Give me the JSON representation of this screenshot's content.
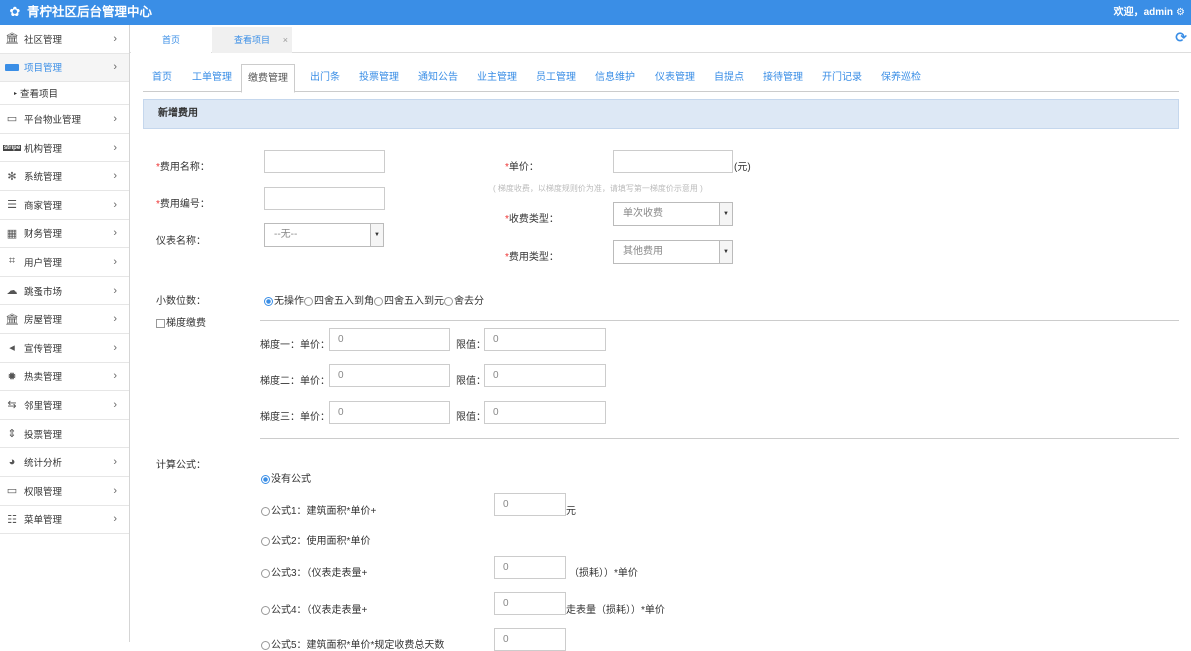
{
  "header": {
    "title": "青柠社区后台管理中心",
    "welcome": "欢迎，admin",
    "gear_icon": "gear-icon"
  },
  "sidebar": {
    "items": [
      {
        "label": "社区管理",
        "icon": "bank-icon"
      },
      {
        "label": "项目管理",
        "icon": "project-icon"
      },
      {
        "label": "平台物业管理",
        "icon": "monitor-icon"
      },
      {
        "label": "机构管理",
        "icon": "stripe-icon"
      },
      {
        "label": "系统管理",
        "icon": "fan-icon"
      },
      {
        "label": "商家管理",
        "icon": "menu-icon"
      },
      {
        "label": "财务管理",
        "icon": "calculator-icon"
      },
      {
        "label": "用户管理",
        "icon": "crop-icon"
      },
      {
        "label": "跳蚤市场",
        "icon": "cloud-icon"
      },
      {
        "label": "房屋管理",
        "icon": "bank-icon"
      },
      {
        "label": "宣传管理",
        "icon": "volume-icon"
      },
      {
        "label": "热卖管理",
        "icon": "settings-icon"
      },
      {
        "label": "邻里管理",
        "icon": "retweet-icon"
      },
      {
        "label": "投票管理",
        "icon": "sort-icon"
      },
      {
        "label": "统计分析",
        "icon": "pie-chart-icon"
      },
      {
        "label": "权限管理",
        "icon": "monitor-icon"
      },
      {
        "label": "菜单管理",
        "icon": "list-icon"
      }
    ],
    "subitem": "查看项目"
  },
  "tabs": [
    {
      "label": "首页"
    },
    {
      "label": "查看项目",
      "close": "×"
    }
  ],
  "subnav": [
    "首页",
    "工单管理",
    "缴费管理",
    "出门条",
    "投票管理",
    "通知公告",
    "业主管理",
    "员工管理",
    "信息维护",
    "仪表管理",
    "自提点",
    "接待管理",
    "开门记录",
    "保养巡检"
  ],
  "form": {
    "heading": "新增费用",
    "fee_name_label": "费用名称：",
    "fee_code_label": "费用编号：",
    "meter_name_label": "仪表名称：",
    "meter_name_value": "--无--",
    "unit_price_label": "单价：",
    "unit_price_suffix": "(元)",
    "unit_price_hint": "( 梯度收费，以梯度规则价为准，请填写第一梯度价示意用 )",
    "charge_type_label": "收费类型：",
    "charge_type_value": "单次收费",
    "fee_type_label": "费用类型：",
    "fee_type_value": "其他费用",
    "decimal_label": "小数位数：",
    "decimal_options": [
      "无操作",
      "四舍五入到角",
      "四舍五入到元",
      "舍去分"
    ],
    "tier_checkbox": "梯度缴费",
    "tiers": [
      {
        "label": "梯度一：单价：",
        "price": "0",
        "limit_label": "限值：",
        "limit": "0"
      },
      {
        "label": "梯度二：单价：",
        "price": "0",
        "limit_label": "限值：",
        "limit": "0"
      },
      {
        "label": "梯度三：单价：",
        "price": "0",
        "limit_label": "限值：",
        "limit": "0"
      }
    ],
    "formula_label": "计算公式：",
    "formulas": [
      {
        "label": "没有公式"
      },
      {
        "label": "公式1：建筑面积*单价+",
        "value": "0",
        "suffix": "元"
      },
      {
        "label": "公式2：使用面积*单价"
      },
      {
        "label": "公式3：（仪表走表量+",
        "value": "0",
        "suffix": "（损耗））*单价"
      },
      {
        "label": "公式4：（仪表走表量+",
        "value": "0",
        "suffix": "走表量（损耗））*单价"
      },
      {
        "label": "公式5：建筑面积*单价*规定收费总天数",
        "value": "0"
      }
    ]
  },
  "colors": {
    "accent": "#3a8ee6",
    "header_bg": "#dde8f5",
    "required": "#e33"
  }
}
